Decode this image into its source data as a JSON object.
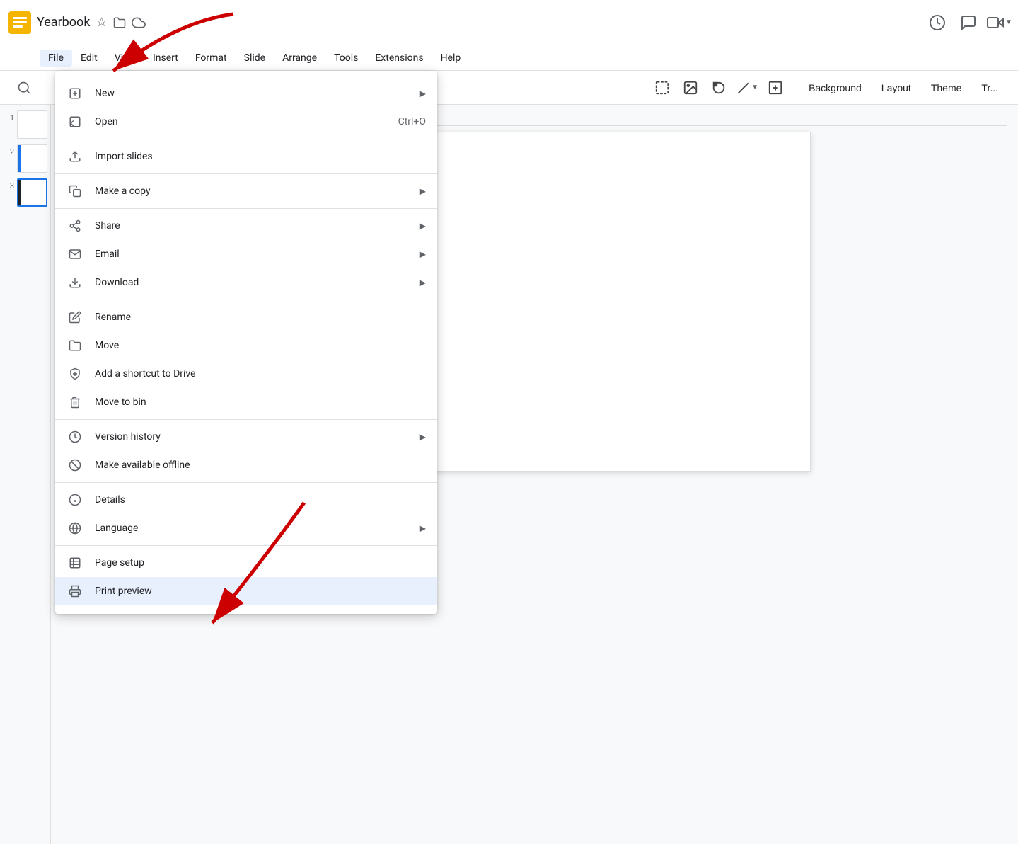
{
  "app": {
    "title": "Yearbook",
    "icon_color": "#F4B400"
  },
  "title_icons": {
    "star": "☆",
    "folder": "📁",
    "cloud": "☁"
  },
  "menu": {
    "items": [
      {
        "label": "File",
        "active": true
      },
      {
        "label": "Edit"
      },
      {
        "label": "View"
      },
      {
        "label": "Insert"
      },
      {
        "label": "Format"
      },
      {
        "label": "Slide"
      },
      {
        "label": "Arrange"
      },
      {
        "label": "Tools"
      },
      {
        "label": "Extensions"
      },
      {
        "label": "Help"
      }
    ]
  },
  "toolbar": {
    "background_label": "Background",
    "layout_label": "Layout",
    "theme_label": "Theme",
    "transition_label": "Tr..."
  },
  "slides": [
    {
      "num": "1",
      "active": false
    },
    {
      "num": "2",
      "active": false,
      "accent": "blue"
    },
    {
      "num": "3",
      "active": true,
      "accent": "dark"
    }
  ],
  "dropdown": {
    "sections": [
      {
        "items": [
          {
            "id": "new",
            "label": "New",
            "has_arrow": true,
            "icon": "new-doc"
          },
          {
            "id": "open",
            "label": "Open",
            "shortcut": "Ctrl+O",
            "icon": "open"
          }
        ]
      },
      {
        "items": [
          {
            "id": "import-slides",
            "label": "Import slides",
            "icon": "import"
          }
        ]
      },
      {
        "items": [
          {
            "id": "make-a-copy",
            "label": "Make a copy",
            "has_arrow": true,
            "icon": "copy"
          }
        ]
      },
      {
        "items": [
          {
            "id": "share",
            "label": "Share",
            "has_arrow": true,
            "icon": "share"
          },
          {
            "id": "email",
            "label": "Email",
            "has_arrow": true,
            "icon": "email"
          },
          {
            "id": "download",
            "label": "Download",
            "has_arrow": true,
            "icon": "download"
          }
        ]
      },
      {
        "items": [
          {
            "id": "rename",
            "label": "Rename",
            "icon": "rename"
          },
          {
            "id": "move",
            "label": "Move",
            "icon": "move"
          },
          {
            "id": "add-shortcut",
            "label": "Add a shortcut to Drive",
            "icon": "shortcut"
          },
          {
            "id": "move-to-bin",
            "label": "Move to bin",
            "icon": "trash"
          }
        ]
      },
      {
        "items": [
          {
            "id": "version-history",
            "label": "Version history",
            "has_arrow": true,
            "icon": "version"
          },
          {
            "id": "make-available-offline",
            "label": "Make available offline",
            "icon": "offline"
          }
        ]
      },
      {
        "items": [
          {
            "id": "details",
            "label": "Details",
            "icon": "info"
          },
          {
            "id": "language",
            "label": "Language",
            "has_arrow": true,
            "icon": "language"
          }
        ]
      },
      {
        "items": [
          {
            "id": "page-setup",
            "label": "Page setup",
            "icon": "page-setup"
          },
          {
            "id": "print-preview",
            "label": "Print preview",
            "icon": "print-preview",
            "highlighted": true
          }
        ]
      }
    ]
  },
  "top_right": {
    "history_icon": "⏱",
    "comment_icon": "💬",
    "video_icon": "📹"
  }
}
